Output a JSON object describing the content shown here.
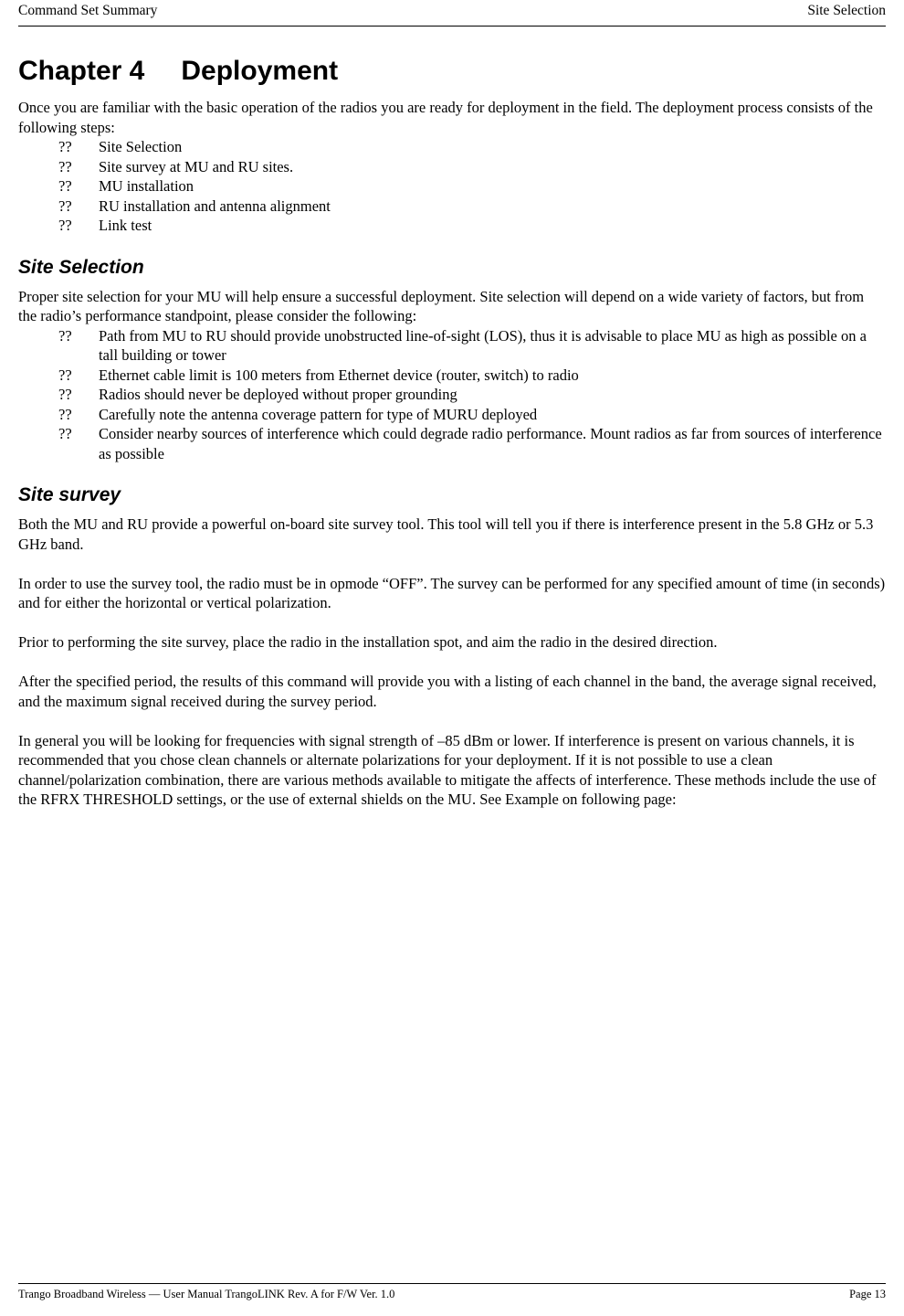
{
  "header": {
    "left": "Command Set Summary",
    "right": "Site Selection"
  },
  "footer": {
    "left": "Trango Broadband Wireless — User Manual TrangoLINK  Rev. A  for F/W Ver. 1.0",
    "right": "Page 13"
  },
  "chapter": {
    "number": "Chapter 4",
    "title": "Deployment"
  },
  "intro": {
    "paragraph": "Once you are familiar with the basic operation of the radios you are ready for deployment in the field.  The deployment process consists of the following steps:",
    "bullet_marker": "??",
    "bullets": [
      "Site Selection",
      "Site survey at MU and RU sites.",
      "MU installation",
      "RU installation and antenna alignment",
      "Link test"
    ]
  },
  "site_selection": {
    "heading": "Site Selection",
    "paragraph": "Proper site selection for your MU will help ensure a successful deployment.   Site selection will depend on a wide variety of factors, but from the radio’s performance standpoint, please consider the following:",
    "bullet_marker": "??",
    "bullets": [
      "Path from MU to RU should provide unobstructed line-of-sight (LOS), thus it is advisable to place MU as high as possible on a tall building or tower",
      "Ethernet cable limit is 100 meters from Ethernet device (router, switch) to radio",
      "Radios should never be deployed without proper grounding",
      "Carefully note the antenna coverage pattern for type of MURU deployed",
      "Consider nearby sources of interference which could degrade radio performance.  Mount radios as far from sources of interference as possible"
    ]
  },
  "site_survey": {
    "heading": "Site survey",
    "paragraphs": [
      "Both the MU and RU provide a powerful on-board site survey tool.  This tool will tell you if there is interference present in the 5.8 GHz or 5.3 GHz band.",
      "In order to use the survey tool, the radio must be in opmode “OFF”.  The survey can be performed for any specified amount of time (in seconds) and for either the horizontal or vertical polarization.",
      "Prior to performing the site survey, place the radio in the installation spot, and aim the radio in the desired direction.",
      "After the specified period, the results of this command will provide you with a listing of each channel in the band, the average signal received, and the maximum signal received during the survey period.",
      "In general you will be looking for frequencies with signal strength of –85 dBm or lower.  If interference is present on various channels, it is recommended that you chose clean channels or alternate polarizations for your deployment.  If it is not possible to use a clean channel/polarization combination, there are various methods available to mitigate the affects of interference.  These methods include the use of the RFRX THRESHOLD settings, or the use of external shields on the MU.  See Example on following page:"
    ]
  }
}
